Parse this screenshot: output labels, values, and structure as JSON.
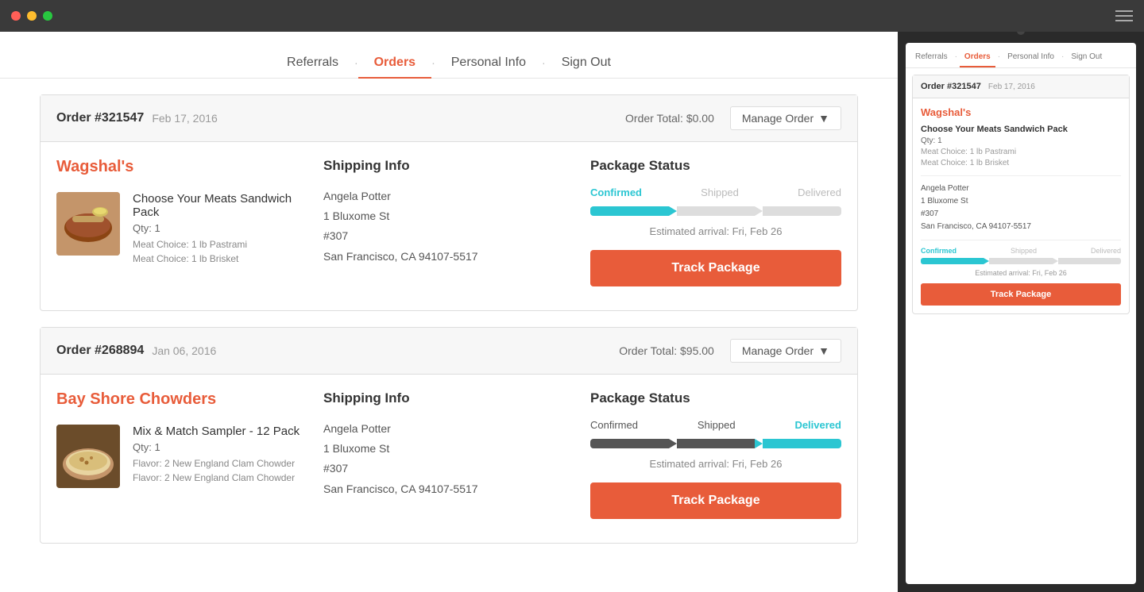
{
  "window": {
    "dots": [
      "red",
      "yellow",
      "green"
    ]
  },
  "nav": {
    "items": [
      {
        "label": "Referrals",
        "active": false
      },
      {
        "label": "Orders",
        "active": true
      },
      {
        "label": "Personal Info",
        "active": false
      },
      {
        "label": "Sign Out",
        "active": false
      }
    ]
  },
  "orders": [
    {
      "id": "Order #321547",
      "date": "Feb 17, 2016",
      "total": "Order Total: $0.00",
      "manage_label": "Manage Order",
      "store": "Wagshal's",
      "product_name": "Choose Your Meats Sandwich Pack",
      "qty": "Qty: 1",
      "meta1": "Meat Choice: 1 lb Pastrami",
      "meta2": "Meat Choice: 1 lb Brisket",
      "shipping_label": "Shipping Info",
      "shipping_name": "Angela Potter",
      "shipping_addr1": "1 Bluxome St",
      "shipping_addr2": "#307",
      "shipping_city": "San Francisco, CA 94107-5517",
      "status_label": "Package Status",
      "status_confirmed": "Confirmed",
      "status_shipped": "Shipped",
      "status_delivered": "Delivered",
      "status_active": "confirmed",
      "estimated": "Estimated arrival: Fri, Feb 26",
      "track_label": "Track Package"
    },
    {
      "id": "Order #268894",
      "date": "Jan 06, 2016",
      "total": "Order Total: $95.00",
      "manage_label": "Manage Order",
      "store": "Bay Shore Chowders",
      "product_name": "Mix & Match Sampler - 12 Pack",
      "qty": "Qty: 1",
      "meta1": "Flavor: 2 New England Clam Chowder",
      "meta2": "Flavor: 2 New England Clam Chowder",
      "shipping_label": "Shipping Info",
      "shipping_name": "Angela Potter",
      "shipping_addr1": "1 Bluxome St",
      "shipping_addr2": "#307",
      "shipping_city": "San Francisco, CA 94107-5517",
      "status_label": "Package Status",
      "status_confirmed": "Confirmed",
      "status_shipped": "Shipped",
      "status_delivered": "Delivered",
      "status_active": "delivered",
      "estimated": "Estimated arrival: Fri, Feb 26",
      "track_label": "Track Package"
    }
  ],
  "mobile": {
    "nav": [
      "Referrals",
      "Orders",
      "Personal Info",
      "Sign Out"
    ],
    "order_id": "Order #321547",
    "order_date": "Feb 17, 2016",
    "store": "Wagshal's",
    "product_name": "Choose Your Meats Sandwich Pack",
    "qty": "Qty: 1",
    "meta1": "Meat Choice: 1 lb Pastrami",
    "meta2": "Meat Choice: 1 lb Brisket",
    "shipping_name": "Angela Potter",
    "shipping_addr1": "1 Bluxome St",
    "shipping_addr2": "#307",
    "shipping_city": "San Francisco, CA 94107-5517",
    "status_confirmed": "Confirmed",
    "status_shipped": "Shipped",
    "status_delivered": "Delivered",
    "estimated": "Estimated arrival: Fri, Feb 26",
    "track_label": "Track Package"
  }
}
